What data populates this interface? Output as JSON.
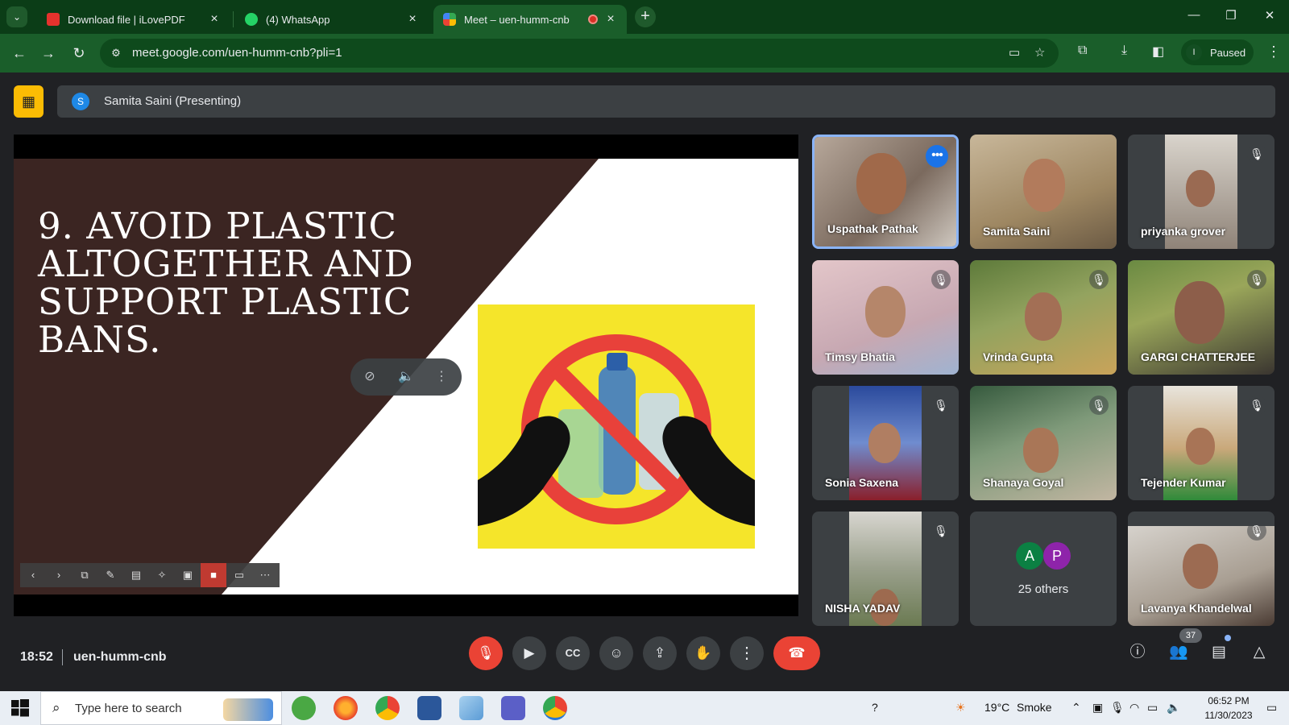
{
  "browser": {
    "tabs": [
      {
        "label": "Download file | iLovePDF",
        "active": false
      },
      {
        "label": "(4) WhatsApp",
        "active": false
      },
      {
        "label": "Meet – uen-humm-cnb",
        "active": true
      }
    ],
    "url": "meet.google.com/uen-humm-cnb?pli=1",
    "profile_initial": "I",
    "profile_status": "Paused"
  },
  "meet": {
    "presenter_initial": "S",
    "presenter_label": "Samita Saini (Presenting)",
    "slide": {
      "title_lines": [
        "9. AVOID PLASTIC",
        "ALTOGETHER AND",
        "SUPPORT PLASTIC",
        "BANS."
      ]
    },
    "participants": [
      {
        "name": "Uspathak Pathak",
        "muted": false,
        "speaking": true
      },
      {
        "name": "Samita Saini",
        "muted": false,
        "speaking": false
      },
      {
        "name": "priyanka grover",
        "muted": true,
        "speaking": false
      },
      {
        "name": "Timsy Bhatia",
        "muted": true,
        "speaking": false
      },
      {
        "name": "Vrinda Gupta",
        "muted": true,
        "speaking": false
      },
      {
        "name": "GARGI CHATTERJEE",
        "muted": true,
        "speaking": false
      },
      {
        "name": "Sonia Saxena",
        "muted": true,
        "speaking": false
      },
      {
        "name": "Shanaya Goyal",
        "muted": true,
        "speaking": false
      },
      {
        "name": "Tejender Kumar",
        "muted": true,
        "speaking": false
      },
      {
        "name": "NISHA YADAV",
        "muted": true,
        "speaking": false
      },
      {
        "name": "Lavanya Khandelwal",
        "muted": true,
        "speaking": false
      }
    ],
    "others": {
      "avatars": [
        {
          "initial": "A",
          "color": "#0b8043"
        },
        {
          "initial": "P",
          "color": "#8e24aa"
        }
      ],
      "label": "25 others"
    },
    "time": "18:52",
    "meeting_code": "uen-humm-cnb",
    "people_count": "37"
  },
  "taskbar": {
    "search_placeholder": "Type here to search",
    "weather_temp": "19°C",
    "weather_desc": "Smoke",
    "clock_time": "06:52 PM",
    "clock_date": "11/30/2023"
  },
  "colors": {
    "chrome_green": "#1a5e2a",
    "meet_bg": "#202124",
    "end_call_red": "#ea4335",
    "slide_brown": "#3b2522",
    "slide_yellow": "#f5e52a"
  }
}
